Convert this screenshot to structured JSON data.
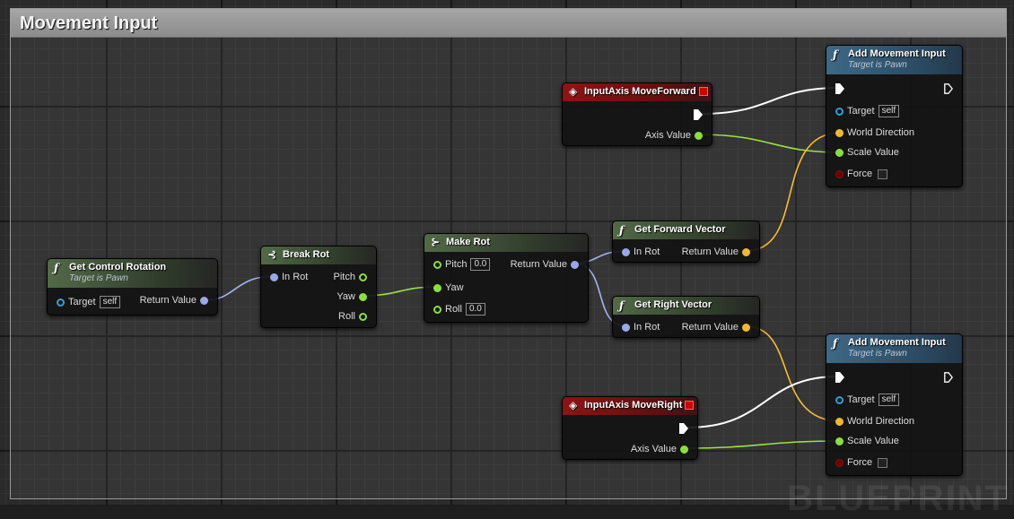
{
  "comment": {
    "title": "Movement Input",
    "watermark": "BLUEPRINT"
  },
  "colors": {
    "struct_wire": "#a4b4f4",
    "float_wire": "#9be244",
    "vector_wire": "#f5bd32",
    "exec_wire": "#ffffff"
  },
  "nodes": {
    "get_control_rotation": {
      "title": "Get Control Rotation",
      "subtitle": "Target is Pawn",
      "icon": "function-icon",
      "target_label": "Target",
      "target_value": "self",
      "return_label": "Return Value"
    },
    "break_rot": {
      "title": "Break Rot",
      "icon": "break-struct-icon",
      "in_label": "In Rot",
      "pitch_label": "Pitch",
      "yaw_label": "Yaw",
      "roll_label": "Roll"
    },
    "make_rot": {
      "title": "Make Rot",
      "icon": "make-struct-icon",
      "pitch_label": "Pitch",
      "pitch_value": "0.0",
      "yaw_label": "Yaw",
      "roll_label": "Roll",
      "roll_value": "0.0",
      "return_label": "Return Value"
    },
    "input_move_forward": {
      "title": "InputAxis MoveForward",
      "icon": "event-icon",
      "axis_label": "Axis Value"
    },
    "input_move_right": {
      "title": "InputAxis MoveRight",
      "icon": "event-icon",
      "axis_label": "Axis Value"
    },
    "get_forward_vector": {
      "title": "Get Forward Vector",
      "icon": "function-icon",
      "in_label": "In Rot",
      "return_label": "Return Value"
    },
    "get_right_vector": {
      "title": "Get Right Vector",
      "icon": "function-icon",
      "in_label": "In Rot",
      "return_label": "Return Value"
    },
    "add_movement_input_1": {
      "title": "Add Movement Input",
      "subtitle": "Target is Pawn",
      "icon": "function-icon",
      "target_label": "Target",
      "target_value": "self",
      "world_dir_label": "World Direction",
      "scale_label": "Scale Value",
      "force_label": "Force"
    },
    "add_movement_input_2": {
      "title": "Add Movement Input",
      "subtitle": "Target is Pawn",
      "icon": "function-icon",
      "target_label": "Target",
      "target_value": "self",
      "world_dir_label": "World Direction",
      "scale_label": "Scale Value",
      "force_label": "Force"
    }
  },
  "icons": {
    "function": "ƒ",
    "event": "◈",
    "break": "⊰",
    "make": "⊱"
  }
}
